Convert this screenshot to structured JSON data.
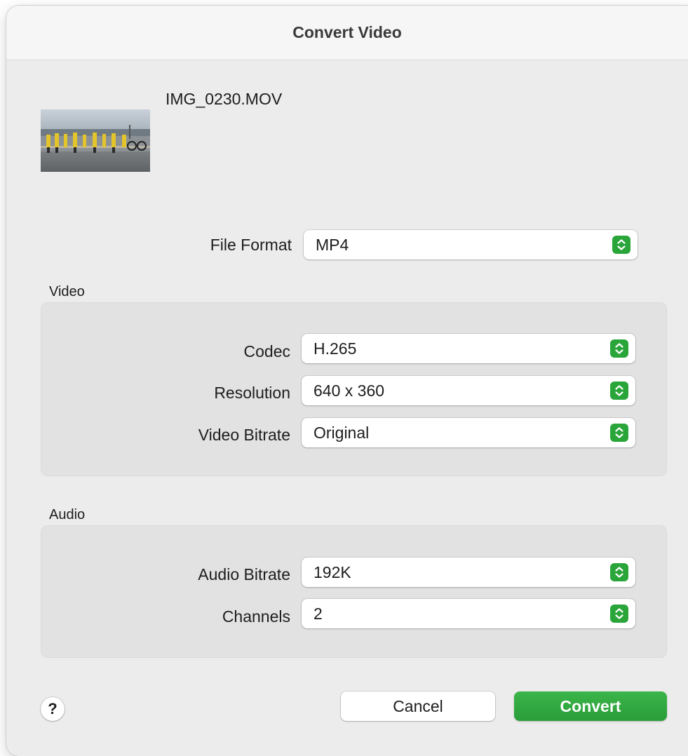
{
  "dialog": {
    "title": "Convert Video",
    "accent_color": "#2aa53a"
  },
  "file": {
    "name": "IMG_0230.MOV",
    "thumbnail": "video-thumbnail"
  },
  "format": {
    "label": "File Format",
    "value": "MP4"
  },
  "video": {
    "section_label": "Video",
    "codec": {
      "label": "Codec",
      "value": "H.265"
    },
    "resolution": {
      "label": "Resolution",
      "value": "640 x 360"
    },
    "bitrate": {
      "label": "Video Bitrate",
      "value": "Original"
    }
  },
  "audio": {
    "section_label": "Audio",
    "bitrate": {
      "label": "Audio Bitrate",
      "value": "192K"
    },
    "channels": {
      "label": "Channels",
      "value": "2"
    }
  },
  "footer": {
    "help_label": "?",
    "cancel_label": "Cancel",
    "convert_label": "Convert"
  },
  "icons": {
    "popup_arrows": "up-down-chevron-icon",
    "help": "question-mark-icon"
  }
}
